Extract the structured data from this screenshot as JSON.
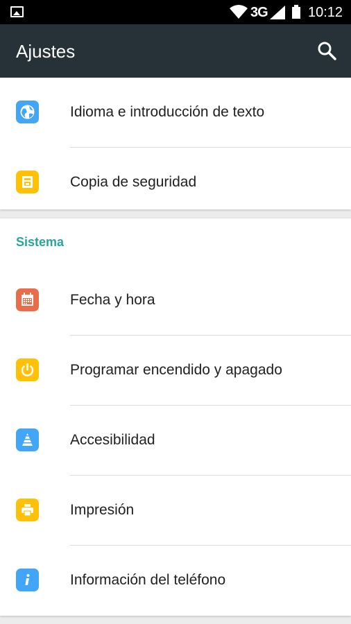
{
  "status_bar": {
    "network_type": "3G",
    "time": "10:12",
    "icons": [
      "image-notification-icon",
      "wifi-icon",
      "signal-icon",
      "battery-icon"
    ]
  },
  "app_bar": {
    "title": "Ajustes",
    "search_icon": "search-icon"
  },
  "personal_items": [
    {
      "label": "Idioma e introducción de texto",
      "icon": "globe-icon",
      "color": "#42a5f5"
    },
    {
      "label": "Copia de seguridad",
      "icon": "backup-icon",
      "color": "#ffc107"
    }
  ],
  "system_section": {
    "header": "Sistema",
    "header_color": "#26a69a",
    "items": [
      {
        "label": "Fecha y hora",
        "icon": "calendar-icon",
        "color": "#e96d4a"
      },
      {
        "label": "Programar encendido y apagado",
        "icon": "power-icon",
        "color": "#ffc107"
      },
      {
        "label": "Accesibilidad",
        "icon": "accessibility-icon",
        "color": "#42a5f5"
      },
      {
        "label": "Impresión",
        "icon": "printer-icon",
        "color": "#ffc107"
      },
      {
        "label": "Información del teléfono",
        "icon": "info-icon",
        "color": "#42a5f5"
      }
    ]
  }
}
